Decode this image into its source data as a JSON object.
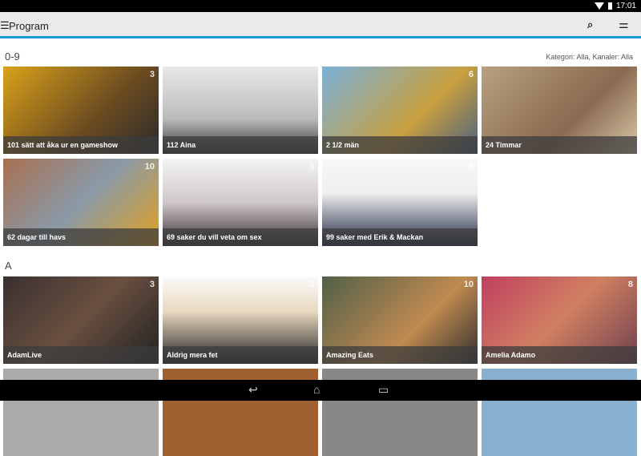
{
  "status": {
    "time": "17:01"
  },
  "appbar": {
    "menu_icon": "☰",
    "title": "Program",
    "search_icon": "⌕",
    "filter_icon": "⚌"
  },
  "sections": [
    {
      "label": "0-9",
      "filter_info": "Kategori: Alla, Kanaler: Alla"
    },
    {
      "label": "A"
    }
  ],
  "tiles": [
    {
      "title": "101 sätt att åka ur en gameshow",
      "channel": "3",
      "bg": "linear-gradient(135deg,#d9a21a,#6a4a20 60%,#2a2a2a)"
    },
    {
      "title": "112 Aina",
      "channel": "",
      "bg": "linear-gradient(180deg,#e8e8e8,#bbb 60%,#333)"
    },
    {
      "title": "2 1/2 män",
      "channel": "6",
      "bg": "linear-gradient(135deg,#7ab0d8,#c9a040 60%,#4a6080)"
    },
    {
      "title": "24 Timmar",
      "channel": "",
      "bg": "linear-gradient(135deg,#b8a080,#8a6a50 60%,#d8c8a8)"
    },
    {
      "title": "62 dagar till havs",
      "channel": "10",
      "bg": "linear-gradient(135deg,#a87050,#8a9aa8 50%,#e0a020)"
    },
    {
      "title": "69 saker du vill veta om sex",
      "channel": "3",
      "bg": "linear-gradient(180deg,#f4f4f4,#d0c8c8 50%,#302830)"
    },
    {
      "title": "99 saker med Erik & Mackan",
      "channel": "6",
      "bg": "linear-gradient(180deg,#f8f8f8,#eee 40%,#1a2440)"
    },
    {
      "title": "AdamLive",
      "channel": "3",
      "bg": "linear-gradient(135deg,#3a3030,#6a5040 50%,#222)"
    },
    {
      "title": "Aldrig mera fet",
      "channel": "3",
      "bg": "linear-gradient(180deg,#fafafa,#e8d8c0 40%,#222)"
    },
    {
      "title": "Amazing Eats",
      "channel": "10",
      "bg": "linear-gradient(135deg,#506048,#c08a50 60%,#303030)"
    },
    {
      "title": "Amelia Adamo",
      "channel": "8",
      "bg": "linear-gradient(135deg,#c04060,#d08060 50%,#704050)"
    },
    {
      "title": "",
      "channel": "",
      "bg": "#aaa"
    },
    {
      "title": "",
      "channel": "",
      "bg": "#a06030"
    },
    {
      "title": "",
      "channel": "",
      "bg": "#888"
    },
    {
      "title": "",
      "channel": "",
      "bg": "#8ab0d0"
    }
  ],
  "nav": {
    "back": "↩",
    "home": "⌂",
    "recents": "▭"
  }
}
